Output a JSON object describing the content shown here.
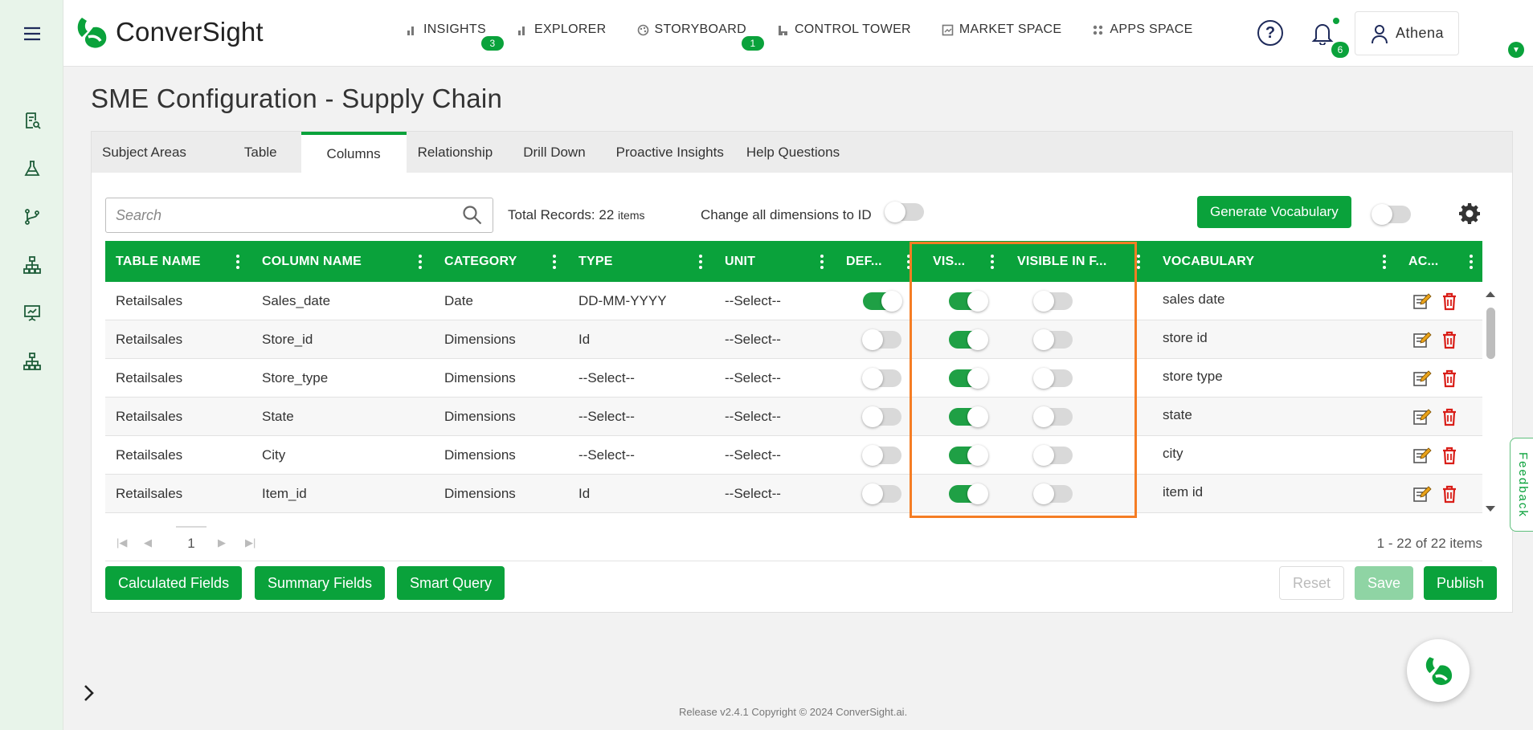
{
  "app": {
    "logo_text": "ConverSight",
    "brand_color": "#0aa23b"
  },
  "nav": [
    {
      "label": "INSIGHTS",
      "badge": "3",
      "icon": "bar-chart-icon"
    },
    {
      "label": "EXPLORER",
      "badge": "",
      "icon": "bar-chart-icon"
    },
    {
      "label": "STORYBOARD",
      "badge": "1",
      "icon": "palette-icon"
    },
    {
      "label": "CONTROL TOWER",
      "badge": "",
      "icon": "tower-icon"
    },
    {
      "label": "MARKET SPACE",
      "badge": "",
      "icon": "market-icon"
    },
    {
      "label": "APPS SPACE",
      "badge": "",
      "icon": "apps-grid-icon"
    }
  ],
  "header": {
    "help_label": "?",
    "notifications_count": "6",
    "user_name": "Athena"
  },
  "page": {
    "title": "SME Configuration - Supply Chain"
  },
  "tabs": [
    {
      "label": "Subject Areas",
      "active": false
    },
    {
      "label": "Table",
      "active": false
    },
    {
      "label": "Columns",
      "active": true
    },
    {
      "label": "Relationship",
      "active": false
    },
    {
      "label": "Drill Down",
      "active": false
    },
    {
      "label": "Proactive Insights",
      "active": false
    },
    {
      "label": "Help Questions",
      "active": false
    }
  ],
  "toolbar": {
    "search_placeholder": "Search",
    "total_label": "Total Records: 22",
    "total_unit": "items",
    "change_dims_label": "Change all dimensions to ID",
    "change_dims_on": false,
    "generate_label": "Generate Vocabulary",
    "generate_toggle_on": false
  },
  "columns": [
    "TABLE NAME",
    "COLUMN NAME",
    "CATEGORY",
    "TYPE",
    "UNIT",
    "DEF...",
    "VIS...",
    "VISIBLE IN F...",
    "VOCABULARY",
    "AC..."
  ],
  "rows": [
    {
      "table": "Retailsales",
      "column": "Sales_date",
      "category": "Date",
      "type": "DD-MM-YYYY",
      "unit": "--Select--",
      "def": true,
      "vis": true,
      "vis_f": false,
      "vocab": "sales date"
    },
    {
      "table": "Retailsales",
      "column": "Store_id",
      "category": "Dimensions",
      "type": "Id",
      "unit": "--Select--",
      "def": false,
      "vis": true,
      "vis_f": false,
      "vocab": "store id"
    },
    {
      "table": "Retailsales",
      "column": "Store_type",
      "category": "Dimensions",
      "type": "--Select--",
      "unit": "--Select--",
      "def": false,
      "vis": true,
      "vis_f": false,
      "vocab": "store type"
    },
    {
      "table": "Retailsales",
      "column": "State",
      "category": "Dimensions",
      "type": "--Select--",
      "unit": "--Select--",
      "def": false,
      "vis": true,
      "vis_f": false,
      "vocab": "state"
    },
    {
      "table": "Retailsales",
      "column": "City",
      "category": "Dimensions",
      "type": "--Select--",
      "unit": "--Select--",
      "def": false,
      "vis": true,
      "vis_f": false,
      "vocab": "city"
    },
    {
      "table": "Retailsales",
      "column": "Item_id",
      "category": "Dimensions",
      "type": "Id",
      "unit": "--Select--",
      "def": false,
      "vis": true,
      "vis_f": false,
      "vocab": "item id"
    }
  ],
  "pager": {
    "page": "1",
    "info": "1 - 22 of 22 items"
  },
  "buttons": {
    "calculated": "Calculated Fields",
    "summary": "Summary Fields",
    "smart": "Smart Query",
    "reset": "Reset",
    "save": "Save",
    "publish": "Publish"
  },
  "feedback_label": "Feedback",
  "footer": "Release v2.4.1 Copyright © 2024 ConverSight.ai.",
  "highlight_color": "#f57d24"
}
